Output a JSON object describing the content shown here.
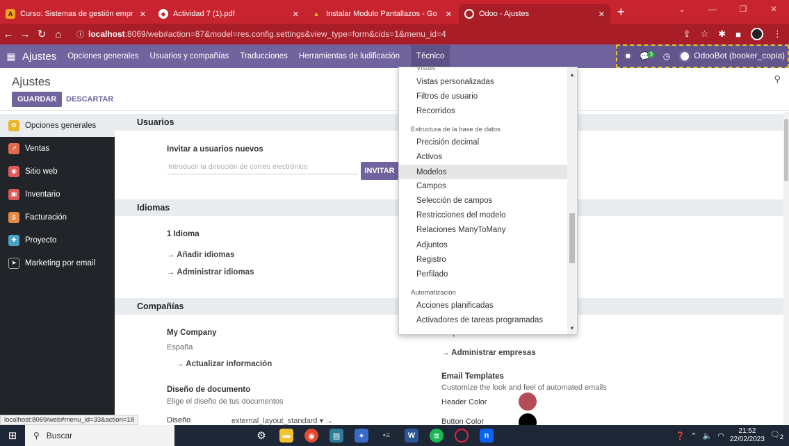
{
  "browser": {
    "tabs": [
      {
        "title": "Curso: Sistemas de gestión empr",
        "icon": "moodle-icon",
        "active": false
      },
      {
        "title": "Actividad 7 (1).pdf",
        "icon": "pdf-icon",
        "active": false
      },
      {
        "title": "Instalar Modulo Pantallazos - Go",
        "icon": "drive-icon",
        "active": false
      },
      {
        "title": "Odoo - Ajustes",
        "icon": "odoo-icon",
        "active": true
      }
    ],
    "url_host": "localhost",
    "url_path": ":8069/web#action=87&model=res.config.settings&view_type=form&cids=1&menu_id=4",
    "status_url": "localhost:8069/web#menu_id=33&action=18"
  },
  "navbar": {
    "brand": "Ajustes",
    "menu": [
      "Opciones generales",
      "Usuarios y compañías",
      "Traducciones",
      "Herramientas de ludificación",
      "Técnico"
    ],
    "chat_badge": "3",
    "user": "OdooBot (booker_copia)"
  },
  "control": {
    "breadcrumb": "Ajustes",
    "save": "GUARDAR",
    "discard": "DESCARTAR"
  },
  "sidebar": {
    "items": [
      {
        "label": "Opciones generales",
        "color": "#e9b52a"
      },
      {
        "label": "Ventas",
        "color": "#e06a4b"
      },
      {
        "label": "Sitio web",
        "color": "#e45a5a"
      },
      {
        "label": "Inventario",
        "color": "#d95757"
      },
      {
        "label": "Facturación",
        "color": "#e48948"
      },
      {
        "label": "Proyecto",
        "color": "#4aa2c6"
      },
      {
        "label": "Marketing por email",
        "color": "#212529"
      }
    ]
  },
  "main": {
    "users": {
      "title": "Usuarios",
      "invite_label": "Invitar a usuarios nuevos",
      "email_placeholder": "Introducir la dirección de correo electrónico",
      "invite_btn": "INVITAR"
    },
    "languages": {
      "title": "Idiomas",
      "count": "1 Idioma",
      "add": "→ Añadir idiomas",
      "manage": "→ Administrar idiomas"
    },
    "companies": {
      "title": "Compañías",
      "company_name": "My Company",
      "country": "España",
      "update": "→ Actualizar información",
      "empresa_partial": "Empresa",
      "manage_companies": "→ Administrar empresas",
      "doc_layout_title": "Diseño de documento",
      "doc_layout_desc": "Elige el diseño de tus documentos",
      "layout_label": "Diseño",
      "layout_value": "external_layout_standard ▾ →",
      "email_templates_title": "Email Templates",
      "email_templates_desc": "Customize the look and feel of automated emails",
      "header_color_label": "Header Color",
      "header_color": "#b64b55",
      "button_color_label": "Button Color",
      "button_color": "#000000"
    }
  },
  "dropdown": {
    "partial_top": "Vistas",
    "items_group1": [
      "Vistas personalizadas",
      "Filtros de usuario",
      "Recorridos"
    ],
    "header2": "Estructura de la base de datos",
    "items_group2": [
      "Precisión decimal",
      "Activos",
      "Modelos",
      "Campos",
      "Selección de campos",
      "Restricciones del modelo",
      "Relaciones ManyToMany",
      "Adjuntos",
      "Registro",
      "Perfilado"
    ],
    "header3": "Automatización",
    "items_group3": [
      "Acciones planificadas",
      "Activadores de tareas programadas"
    ],
    "hovered": "Modelos"
  },
  "taskbar": {
    "search": "Buscar",
    "time": "21:52",
    "date": "22/02/2023",
    "notif": "2"
  },
  "colors": {
    "odoo_primary": "#71639e",
    "browser_red": "#c8242f"
  }
}
